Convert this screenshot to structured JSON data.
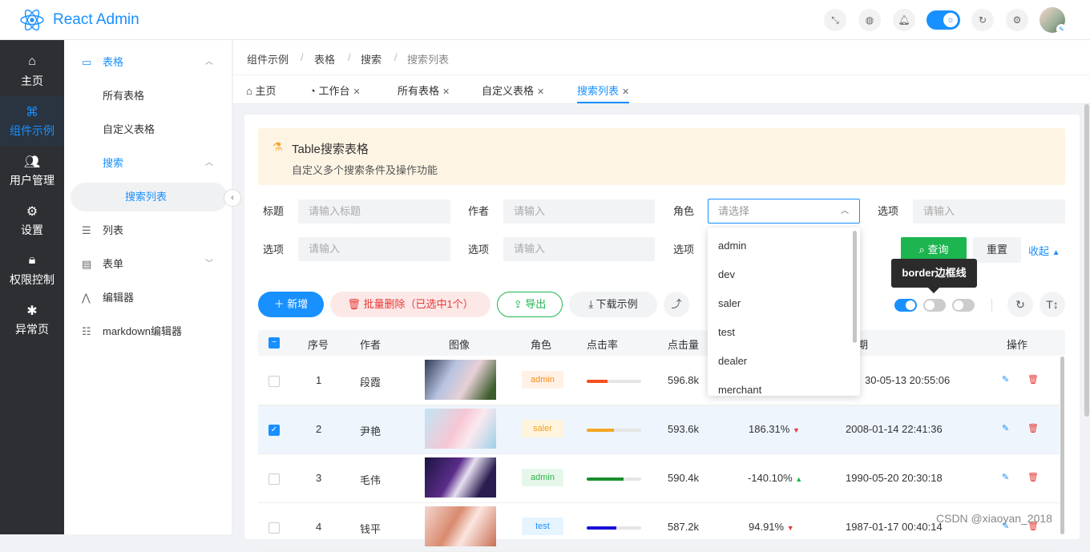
{
  "header": {
    "app_title": "React Admin"
  },
  "side_main": [
    {
      "label": "主页",
      "icon": "home-icon"
    },
    {
      "label": "组件示例",
      "icon": "command-icon"
    },
    {
      "label": "用户管理",
      "icon": "users-icon"
    },
    {
      "label": "设置",
      "icon": "gear-icon"
    },
    {
      "label": "权限控制",
      "icon": "lock-icon"
    },
    {
      "label": "异常页",
      "icon": "bug-icon"
    }
  ],
  "side_sub": {
    "table_group": "表格",
    "all_tables": "所有表格",
    "custom_table": "自定义表格",
    "search_group": "搜索",
    "search_list": "搜索列表",
    "list": "列表",
    "form": "表单",
    "editor": "编辑器",
    "md_editor": "markdown编辑器"
  },
  "breadcrumb": [
    "组件示例",
    "表格",
    "搜索",
    "搜索列表"
  ],
  "tabs": [
    "主页",
    "工作台",
    "所有表格",
    "自定义表格",
    "搜索列表"
  ],
  "alert": {
    "title": "Table搜索表格",
    "desc": "自定义多个搜索条件及操作功能"
  },
  "filters": {
    "title_label": "标题",
    "title_ph": "请输入标题",
    "author_label": "作者",
    "author_ph": "请输入",
    "role_label": "角色",
    "role_ph": "请选择",
    "opt_label": "选项",
    "opt_ph": "请输入",
    "query": "查询",
    "reset": "重置",
    "collapse": "收起"
  },
  "role_options": [
    "admin",
    "dev",
    "saler",
    "test",
    "dealer",
    "merchant"
  ],
  "tooltip": "border边框线",
  "toolbar": {
    "add": "新增",
    "batch_delete": "批量删除（已选中1个）",
    "export": "导出",
    "download": "下载示例"
  },
  "table": {
    "columns": [
      "序号",
      "作者",
      "图像",
      "角色",
      "点击率",
      "点击量",
      "期",
      "操作"
    ],
    "rows": [
      {
        "no": "1",
        "author": "段霞",
        "role": "admin",
        "progress": 0.38,
        "bar_color": "#f4511e",
        "clicks": "596.8k",
        "rate": "",
        "trend": "",
        "date": "30-05-13 20:55:06",
        "checked": false
      },
      {
        "no": "2",
        "author": "尹艳",
        "role": "saler",
        "progress": 0.5,
        "bar_color": "#f5a623",
        "clicks": "593.6k",
        "rate": "186.31%",
        "trend": "down",
        "date": "2008-01-14 22:41:36",
        "checked": true
      },
      {
        "no": "3",
        "author": "毛伟",
        "role": "admin",
        "progress": 0.67,
        "bar_color": "#1a8f2b",
        "clicks": "590.4k",
        "rate": "-140.10%",
        "trend": "up",
        "date": "1990-05-20 20:30:18",
        "checked": false
      },
      {
        "no": "4",
        "author": "钱平",
        "role": "test",
        "progress": 0.55,
        "bar_color": "#1a10d8",
        "clicks": "587.2k",
        "rate": "94.91%",
        "trend": "down",
        "date": "1987-01-17 00:40:14",
        "checked": false
      }
    ]
  },
  "watermark": "CSDN @xiaoyan_2018"
}
